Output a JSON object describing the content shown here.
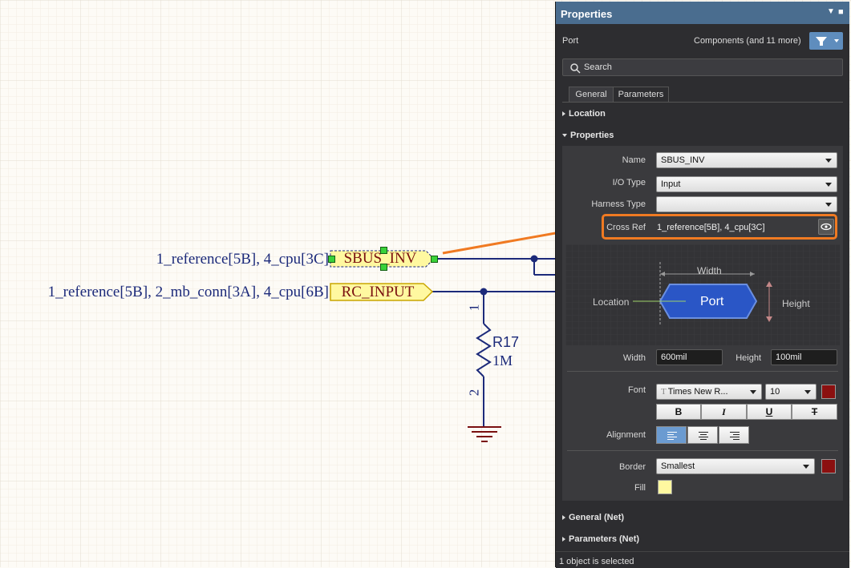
{
  "schematic": {
    "port1": {
      "xref": "1_reference[5B], 4_cpu[3C]",
      "name": "SBUS_INV"
    },
    "port2": {
      "xref": "1_reference[5B], 2_mb_conn[3A], 4_cpu[6B]",
      "name": "RC_INPUT"
    },
    "resistor": {
      "designator": "R17",
      "value": "1M",
      "pin1": "1",
      "pin2": "2"
    }
  },
  "panel": {
    "title": "Properties",
    "object_kind": "Port",
    "filter_text": "Components (and 11 more)",
    "search_placeholder": "Search",
    "tabs": [
      {
        "label": "General",
        "active": true
      },
      {
        "label": "Parameters",
        "active": false
      }
    ],
    "sections": {
      "location": "Location",
      "properties": "Properties",
      "general_net": "General (Net)",
      "parameters_net": "Parameters (Net)"
    },
    "fields": {
      "name_label": "Name",
      "name_value": "SBUS_INV",
      "io_label": "I/O Type",
      "io_value": "Input",
      "harness_label": "Harness Type",
      "harness_value": "",
      "crossref_label": "Cross Ref",
      "crossref_value": "1_reference[5B], 4_cpu[3C]",
      "width_label": "Width",
      "width_value": "600mil",
      "height_label": "Height",
      "height_value": "100mil",
      "font_label": "Font",
      "font_value": "Times New R...",
      "font_size": "10",
      "alignment_label": "Alignment",
      "border_label": "Border",
      "border_value": "Smallest",
      "fill_label": "Fill"
    },
    "diagram": {
      "width": "Width",
      "location": "Location",
      "port": "Port",
      "height": "Height"
    },
    "format_buttons": {
      "bold": "B",
      "italic": "I",
      "underline": "U",
      "strike": "T"
    },
    "status": "1 object is selected"
  },
  "colors": {
    "panel_bg": "#2d2d30",
    "title_bar": "#4a6d8f",
    "highlight_orange": "#f07a22",
    "wire": "#1c2a7a",
    "port_fill": "#fff8a0",
    "port_text": "#7a1010",
    "font_color": "#8b1010",
    "border_color": "#8b1010",
    "fill_color": "#fff8a0",
    "selected_align": "#6b9bd1",
    "port_shape": "#2a56c6"
  },
  "icons": [
    "filter-icon",
    "search-icon",
    "eye-icon",
    "close-icon",
    "pin-icon",
    "dropdown-arrow-icon",
    "ground-icon"
  ]
}
